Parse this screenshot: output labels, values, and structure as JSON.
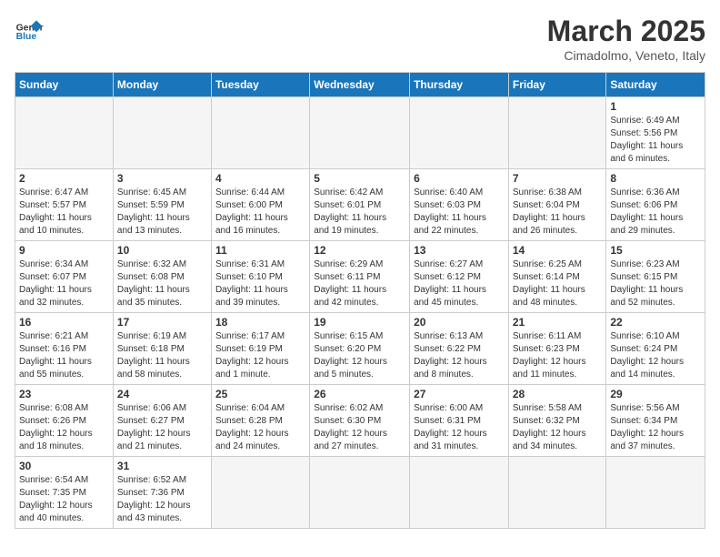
{
  "header": {
    "logo_general": "General",
    "logo_blue": "Blue",
    "month_title": "March 2025",
    "subtitle": "Cimadolmo, Veneto, Italy"
  },
  "weekdays": [
    "Sunday",
    "Monday",
    "Tuesday",
    "Wednesday",
    "Thursday",
    "Friday",
    "Saturday"
  ],
  "weeks": [
    [
      {
        "day": "",
        "info": ""
      },
      {
        "day": "",
        "info": ""
      },
      {
        "day": "",
        "info": ""
      },
      {
        "day": "",
        "info": ""
      },
      {
        "day": "",
        "info": ""
      },
      {
        "day": "",
        "info": ""
      },
      {
        "day": "1",
        "info": "Sunrise: 6:49 AM\nSunset: 5:56 PM\nDaylight: 11 hours\nand 6 minutes."
      }
    ],
    [
      {
        "day": "2",
        "info": "Sunrise: 6:47 AM\nSunset: 5:57 PM\nDaylight: 11 hours\nand 10 minutes."
      },
      {
        "day": "3",
        "info": "Sunrise: 6:45 AM\nSunset: 5:59 PM\nDaylight: 11 hours\nand 13 minutes."
      },
      {
        "day": "4",
        "info": "Sunrise: 6:44 AM\nSunset: 6:00 PM\nDaylight: 11 hours\nand 16 minutes."
      },
      {
        "day": "5",
        "info": "Sunrise: 6:42 AM\nSunset: 6:01 PM\nDaylight: 11 hours\nand 19 minutes."
      },
      {
        "day": "6",
        "info": "Sunrise: 6:40 AM\nSunset: 6:03 PM\nDaylight: 11 hours\nand 22 minutes."
      },
      {
        "day": "7",
        "info": "Sunrise: 6:38 AM\nSunset: 6:04 PM\nDaylight: 11 hours\nand 26 minutes."
      },
      {
        "day": "8",
        "info": "Sunrise: 6:36 AM\nSunset: 6:06 PM\nDaylight: 11 hours\nand 29 minutes."
      }
    ],
    [
      {
        "day": "9",
        "info": "Sunrise: 6:34 AM\nSunset: 6:07 PM\nDaylight: 11 hours\nand 32 minutes."
      },
      {
        "day": "10",
        "info": "Sunrise: 6:32 AM\nSunset: 6:08 PM\nDaylight: 11 hours\nand 35 minutes."
      },
      {
        "day": "11",
        "info": "Sunrise: 6:31 AM\nSunset: 6:10 PM\nDaylight: 11 hours\nand 39 minutes."
      },
      {
        "day": "12",
        "info": "Sunrise: 6:29 AM\nSunset: 6:11 PM\nDaylight: 11 hours\nand 42 minutes."
      },
      {
        "day": "13",
        "info": "Sunrise: 6:27 AM\nSunset: 6:12 PM\nDaylight: 11 hours\nand 45 minutes."
      },
      {
        "day": "14",
        "info": "Sunrise: 6:25 AM\nSunset: 6:14 PM\nDaylight: 11 hours\nand 48 minutes."
      },
      {
        "day": "15",
        "info": "Sunrise: 6:23 AM\nSunset: 6:15 PM\nDaylight: 11 hours\nand 52 minutes."
      }
    ],
    [
      {
        "day": "16",
        "info": "Sunrise: 6:21 AM\nSunset: 6:16 PM\nDaylight: 11 hours\nand 55 minutes."
      },
      {
        "day": "17",
        "info": "Sunrise: 6:19 AM\nSunset: 6:18 PM\nDaylight: 11 hours\nand 58 minutes."
      },
      {
        "day": "18",
        "info": "Sunrise: 6:17 AM\nSunset: 6:19 PM\nDaylight: 12 hours\nand 1 minute."
      },
      {
        "day": "19",
        "info": "Sunrise: 6:15 AM\nSunset: 6:20 PM\nDaylight: 12 hours\nand 5 minutes."
      },
      {
        "day": "20",
        "info": "Sunrise: 6:13 AM\nSunset: 6:22 PM\nDaylight: 12 hours\nand 8 minutes."
      },
      {
        "day": "21",
        "info": "Sunrise: 6:11 AM\nSunset: 6:23 PM\nDaylight: 12 hours\nand 11 minutes."
      },
      {
        "day": "22",
        "info": "Sunrise: 6:10 AM\nSunset: 6:24 PM\nDaylight: 12 hours\nand 14 minutes."
      }
    ],
    [
      {
        "day": "23",
        "info": "Sunrise: 6:08 AM\nSunset: 6:26 PM\nDaylight: 12 hours\nand 18 minutes."
      },
      {
        "day": "24",
        "info": "Sunrise: 6:06 AM\nSunset: 6:27 PM\nDaylight: 12 hours\nand 21 minutes."
      },
      {
        "day": "25",
        "info": "Sunrise: 6:04 AM\nSunset: 6:28 PM\nDaylight: 12 hours\nand 24 minutes."
      },
      {
        "day": "26",
        "info": "Sunrise: 6:02 AM\nSunset: 6:30 PM\nDaylight: 12 hours\nand 27 minutes."
      },
      {
        "day": "27",
        "info": "Sunrise: 6:00 AM\nSunset: 6:31 PM\nDaylight: 12 hours\nand 31 minutes."
      },
      {
        "day": "28",
        "info": "Sunrise: 5:58 AM\nSunset: 6:32 PM\nDaylight: 12 hours\nand 34 minutes."
      },
      {
        "day": "29",
        "info": "Sunrise: 5:56 AM\nSunset: 6:34 PM\nDaylight: 12 hours\nand 37 minutes."
      }
    ],
    [
      {
        "day": "30",
        "info": "Sunrise: 6:54 AM\nSunset: 7:35 PM\nDaylight: 12 hours\nand 40 minutes."
      },
      {
        "day": "31",
        "info": "Sunrise: 6:52 AM\nSunset: 7:36 PM\nDaylight: 12 hours\nand 43 minutes."
      },
      {
        "day": "",
        "info": ""
      },
      {
        "day": "",
        "info": ""
      },
      {
        "day": "",
        "info": ""
      },
      {
        "day": "",
        "info": ""
      },
      {
        "day": "",
        "info": ""
      }
    ]
  ]
}
